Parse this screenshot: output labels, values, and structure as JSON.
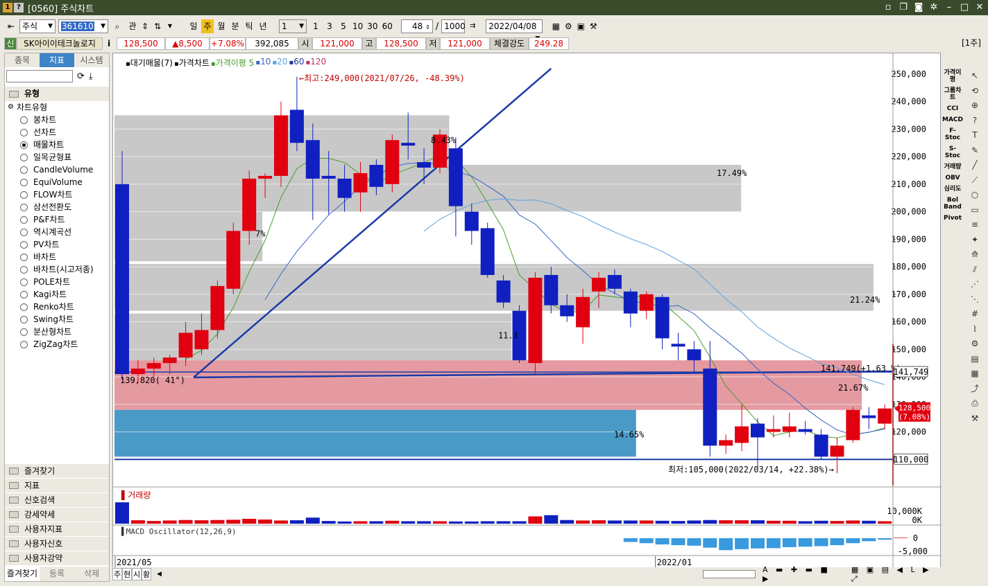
{
  "window": {
    "icon1": "1",
    "icon2": "?",
    "title": "[0560] 주식차트"
  },
  "toolbar": {
    "market": "주식",
    "code": "361610",
    "btn_related": "관",
    "periods": [
      "일",
      "주",
      "월",
      "분",
      "틱",
      "년"
    ],
    "active_period": "주",
    "interval_value": "1",
    "minute_presets": [
      "1",
      "3",
      "5",
      "10",
      "30",
      "60"
    ],
    "count": "48",
    "sep": "/",
    "total": "1000",
    "date": "2022/04/08"
  },
  "quote": {
    "credit": "신",
    "name": "SK아이이테크놀로지",
    "info_btn": "i",
    "price": "128,500",
    "change": "▲8,500",
    "change_pct": "+7.08%",
    "volume": "392,085",
    "open_lbl": "시",
    "open": "121,000",
    "high_lbl": "고",
    "high": "128,500",
    "low_lbl": "저",
    "low": "121,000",
    "strength_lbl": "체결강도",
    "strength": "249.28",
    "unit_badge": "[1주]"
  },
  "left_panel": {
    "tabs": [
      "종목",
      "지표",
      "시스템"
    ],
    "active_tab": "지표",
    "group_title": "유형",
    "tree_root": "차트유형",
    "chart_types": [
      "봉차트",
      "선차트",
      "매물차트",
      "일목균형표",
      "CandleVolume",
      "EquiVolume",
      "FLOW차트",
      "삼선전환도",
      "P&F차트",
      "역시계곡선",
      "PV차트",
      "바차트",
      "바차트(시고저종)",
      "POLE차트",
      "Kagi차트",
      "Renko차트",
      "Swing차트",
      "분산형차트",
      "ZigZag차트"
    ],
    "selected_type": "매물차트",
    "categories": [
      "즐겨찾기",
      "지표",
      "신호검색",
      "강세약세",
      "사용자지표",
      "사용자신호",
      "사용자강약"
    ],
    "bottom_tabs": [
      "즐겨찾기",
      "등록",
      "삭제"
    ]
  },
  "legend": {
    "items": [
      "대기매물(7)",
      "가격차트",
      "가격이평 5",
      "10",
      "20",
      "60",
      "120"
    ],
    "colors": [
      "#000000",
      "#000000",
      "#4a9a2a",
      "#3a62c8",
      "#5aa0e0",
      "#1a3a9a",
      "#c0306a"
    ]
  },
  "annotations": {
    "high": "←최고:249,000(2021/07/26, -48.39%)",
    "low": "최저:105,000(2022/03/14, +22.38%)→",
    "trend_label": "139,820( 41°)",
    "hline_label": "141,749(+1.63 %)",
    "hline_price": 141749,
    "hline_tag": "141,749",
    "support_tag": "110,000",
    "support_price": 110000,
    "price_tag": "128,500",
    "price_tag_pct": "(7.08%)",
    "zone_pcts": [
      "17.49%",
      "21.24%",
      "11.3",
      "7%",
      "21.67%",
      "14.65%",
      "8.43%"
    ]
  },
  "volume_panel": {
    "title": "거래량",
    "axis_labels": [
      "10,000K",
      "0K"
    ]
  },
  "macd_panel": {
    "title": "MACD Oscillator(12,26,9)",
    "axis_labels": [
      "0",
      "-5,000"
    ]
  },
  "x_labels": [
    {
      "label": "2021/05",
      "index": 0
    },
    {
      "label": "2022/01",
      "index": 34
    }
  ],
  "bottom_bar": {
    "tabs": [
      "주",
      "현",
      "시",
      "황"
    ]
  },
  "right_indicators": [
    "가격이평",
    "그룹차트",
    "CCI",
    "MACD",
    "F-Stoc",
    "S-Stoc",
    "거래량",
    "OBV",
    "심리도",
    "Bol Band",
    "Pivot"
  ],
  "chart_data": {
    "type": "candlestick",
    "y_ticks": [
      250000,
      240000,
      230000,
      220000,
      210000,
      200000,
      190000,
      180000,
      170000,
      160000,
      150000,
      140000,
      130000,
      120000,
      110000
    ],
    "ylim": [
      100000,
      255000
    ],
    "candles": [
      {
        "o": 210000,
        "h": 222000,
        "l": 139000,
        "c": 141000
      },
      {
        "o": 141000,
        "h": 146000,
        "l": 138000,
        "c": 143000
      },
      {
        "o": 143000,
        "h": 147000,
        "l": 140000,
        "c": 145000
      },
      {
        "o": 145000,
        "h": 148000,
        "l": 141000,
        "c": 147000
      },
      {
        "o": 147000,
        "h": 160000,
        "l": 144000,
        "c": 156000
      },
      {
        "o": 150000,
        "h": 163000,
        "l": 148000,
        "c": 157000
      },
      {
        "o": 157000,
        "h": 175000,
        "l": 154000,
        "c": 173000
      },
      {
        "o": 172000,
        "h": 196000,
        "l": 170000,
        "c": 193000
      },
      {
        "o": 193000,
        "h": 215000,
        "l": 188000,
        "c": 212000
      },
      {
        "o": 212000,
        "h": 214000,
        "l": 205000,
        "c": 213000
      },
      {
        "o": 213000,
        "h": 240000,
        "l": 209000,
        "c": 235000
      },
      {
        "o": 237000,
        "h": 249000,
        "l": 222000,
        "c": 225000
      },
      {
        "o": 226000,
        "h": 232000,
        "l": 197000,
        "c": 212000
      },
      {
        "o": 213000,
        "h": 222000,
        "l": 199000,
        "c": 212000
      },
      {
        "o": 212000,
        "h": 217000,
        "l": 200000,
        "c": 205000
      },
      {
        "o": 207000,
        "h": 218000,
        "l": 200000,
        "c": 214000
      },
      {
        "o": 217000,
        "h": 219000,
        "l": 206000,
        "c": 209000
      },
      {
        "o": 210000,
        "h": 228000,
        "l": 207000,
        "c": 226000
      },
      {
        "o": 225000,
        "h": 236000,
        "l": 219000,
        "c": 224000
      },
      {
        "o": 218000,
        "h": 223000,
        "l": 210000,
        "c": 216000
      },
      {
        "o": 216000,
        "h": 230000,
        "l": 214000,
        "c": 228000
      },
      {
        "o": 223000,
        "h": 227000,
        "l": 191000,
        "c": 202000
      },
      {
        "o": 200000,
        "h": 203000,
        "l": 188000,
        "c": 193000
      },
      {
        "o": 194000,
        "h": 196000,
        "l": 176000,
        "c": 177000
      },
      {
        "o": 175000,
        "h": 177000,
        "l": 165000,
        "c": 167000
      },
      {
        "o": 164000,
        "h": 166000,
        "l": 145000,
        "c": 146000
      },
      {
        "o": 145000,
        "h": 178000,
        "l": 141000,
        "c": 176000
      },
      {
        "o": 177000,
        "h": 180000,
        "l": 163000,
        "c": 166000
      },
      {
        "o": 166000,
        "h": 170000,
        "l": 160000,
        "c": 162000
      },
      {
        "o": 158000,
        "h": 172000,
        "l": 152000,
        "c": 169000
      },
      {
        "o": 171000,
        "h": 178000,
        "l": 165000,
        "c": 176000
      },
      {
        "o": 177000,
        "h": 179000,
        "l": 170000,
        "c": 172000
      },
      {
        "o": 171000,
        "h": 172000,
        "l": 158000,
        "c": 163000
      },
      {
        "o": 164000,
        "h": 171000,
        "l": 161000,
        "c": 170000
      },
      {
        "o": 169000,
        "h": 170000,
        "l": 150000,
        "c": 154000
      },
      {
        "o": 152000,
        "h": 156000,
        "l": 146000,
        "c": 151000
      },
      {
        "o": 150000,
        "h": 153000,
        "l": 141000,
        "c": 146000
      },
      {
        "o": 143000,
        "h": 153000,
        "l": 111000,
        "c": 115000
      },
      {
        "o": 115000,
        "h": 119000,
        "l": 112000,
        "c": 117000
      },
      {
        "o": 116000,
        "h": 130000,
        "l": 113000,
        "c": 122000
      },
      {
        "o": 123000,
        "h": 125000,
        "l": 106000,
        "c": 118000
      },
      {
        "o": 120000,
        "h": 126000,
        "l": 118000,
        "c": 121000
      },
      {
        "o": 120000,
        "h": 127000,
        "l": 118000,
        "c": 122000
      },
      {
        "o": 121000,
        "h": 124000,
        "l": 119000,
        "c": 120000
      },
      {
        "o": 119000,
        "h": 121000,
        "l": 110000,
        "c": 111000
      },
      {
        "o": 111000,
        "h": 118000,
        "l": 105000,
        "c": 115000
      },
      {
        "o": 117000,
        "h": 129000,
        "l": 116000,
        "c": 128000
      },
      {
        "o": 126000,
        "h": 129000,
        "l": 121000,
        "c": 125000
      },
      {
        "o": 123000,
        "h": 130000,
        "l": 121000,
        "c": 128500
      }
    ],
    "volume_k": [
      8800,
      1400,
      1100,
      1300,
      1500,
      1400,
      1500,
      1600,
      2000,
      1700,
      1300,
      1400,
      2500,
      1100,
      900,
      1000,
      1000,
      1200,
      1000,
      1000,
      1000,
      900,
      900,
      1000,
      1000,
      1000,
      3000,
      3500,
      1500,
      1300,
      1400,
      1300,
      1300,
      1300,
      1200,
      1100,
      1300,
      1500,
      1400,
      1400,
      1400,
      1200,
      1200,
      1000,
      1200,
      1100,
      1300,
      1200,
      1000
    ],
    "macd": [
      0,
      0,
      0,
      0,
      0,
      0,
      0,
      0,
      0,
      0,
      0,
      0,
      0,
      0,
      0,
      0,
      0,
      0,
      0,
      0,
      0,
      0,
      0,
      0,
      0,
      0,
      0,
      0,
      0,
      0,
      0,
      0,
      -1500,
      -2000,
      -2500,
      -2800,
      -3000,
      -3800,
      -4800,
      -4400,
      -4100,
      -4000,
      -3600,
      -3400,
      -3200,
      -2800,
      -2000,
      -1200,
      -600,
      300
    ]
  }
}
